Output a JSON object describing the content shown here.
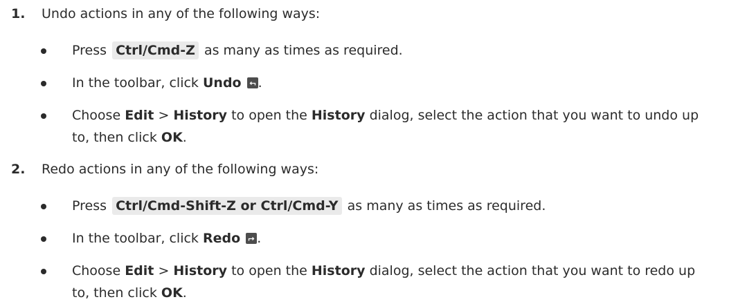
{
  "steps": [
    {
      "number": "1.",
      "text": "Undo actions in any of the following ways:",
      "bullets": {
        "press": {
          "pre": "Press",
          "key": "Ctrl/Cmd-Z",
          "post": "as many as times as required."
        },
        "toolbar": {
          "pre": "In the toolbar, click",
          "action": "Undo",
          "icon": "undo-icon",
          "post": "."
        },
        "history": {
          "pre": "Choose",
          "menu": "Edit",
          "sep": ">",
          "item": "History",
          "mid": "to open the",
          "dialog": "History",
          "rest": "dialog, select the action that you want to undo up to, then click",
          "ok": "OK",
          "end": "."
        }
      }
    },
    {
      "number": "2.",
      "text": "Redo actions in any of the following ways:",
      "bullets": {
        "press": {
          "pre": "Press",
          "key": "Ctrl/Cmd-Shift-Z or Ctrl/Cmd-Y",
          "post": "as many as times as required."
        },
        "toolbar": {
          "pre": "In the toolbar, click",
          "action": "Redo",
          "icon": "redo-icon",
          "post": "."
        },
        "history": {
          "pre": "Choose",
          "menu": "Edit",
          "sep": ">",
          "item": "History",
          "mid": "to open the",
          "dialog": "History",
          "rest": "dialog, select the action that you want to redo up to, then click",
          "ok": "OK",
          "end": "."
        }
      }
    }
  ],
  "colors": {
    "text": "#2b2b2b",
    "key_background": "#eaeaea",
    "icon_background": "#4d4d4d"
  }
}
